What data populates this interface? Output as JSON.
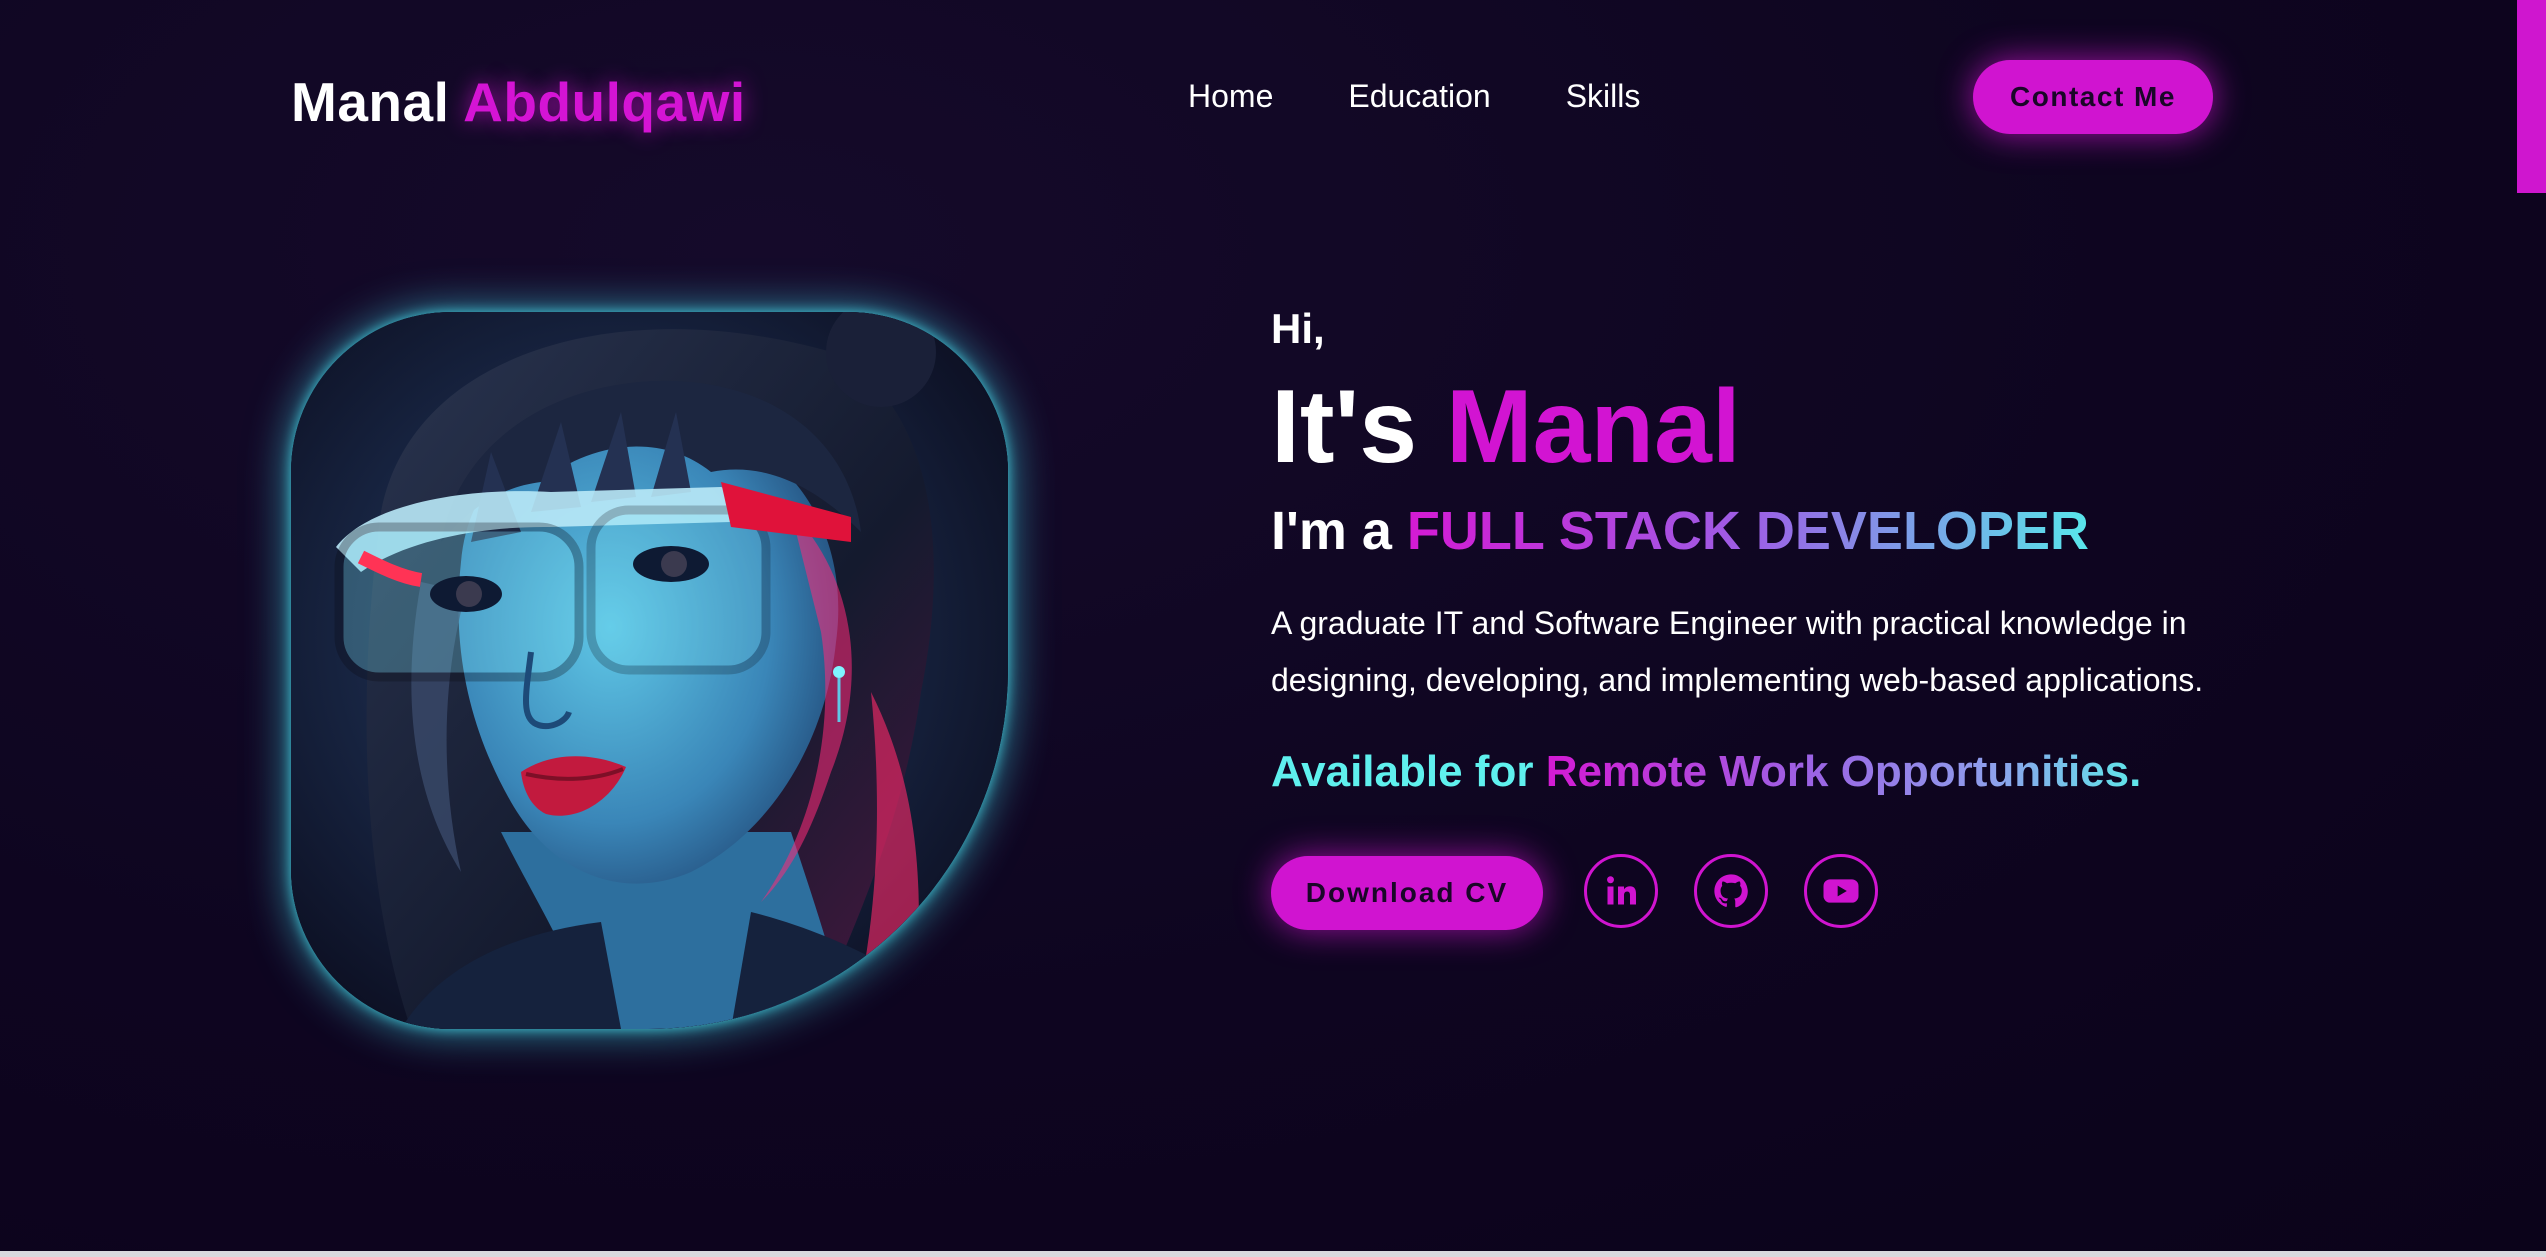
{
  "brand": {
    "first_name": "Manal",
    "last_name": "Abdulqawi"
  },
  "nav": {
    "items": [
      {
        "label": "Home"
      },
      {
        "label": "Education"
      },
      {
        "label": "Skills"
      }
    ]
  },
  "header": {
    "contact_label": "Contact Me"
  },
  "hero": {
    "greeting": "Hi,",
    "intro_prefix": "It's",
    "intro_name": "Manal",
    "role_prefix": "I'm a",
    "role": "FULL STACK DEVELOPER",
    "description": "A graduate IT and Software Engineer with practical knowledge in designing, developing, and implementing web-based applications.",
    "available_prefix": "Available for",
    "available_rest": "Remote Work Opportunities.",
    "download_label": "Download CV"
  },
  "social": {
    "items": [
      {
        "icon": "linkedin-icon"
      },
      {
        "icon": "github-icon"
      },
      {
        "icon": "youtube-icon"
      }
    ]
  },
  "colors": {
    "background": "#0f0620",
    "accent": "#d014d0",
    "cyan": "#5ff0ee",
    "text": "#ffffff"
  }
}
